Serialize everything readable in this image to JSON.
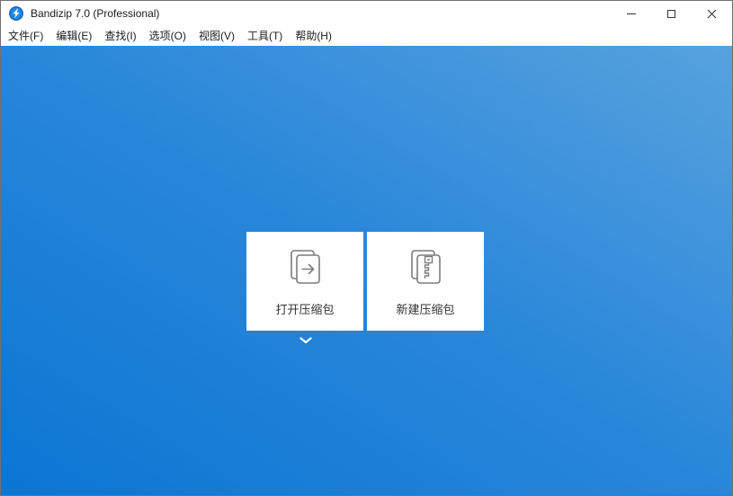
{
  "window": {
    "title": "Bandizip 7.0 (Professional)",
    "controls": {
      "minimize": "minimize-icon",
      "maximize": "maximize-icon",
      "close": "close-icon"
    }
  },
  "menu": {
    "items": [
      {
        "label": "文件(F)"
      },
      {
        "label": "编辑(E)"
      },
      {
        "label": "查找(I)"
      },
      {
        "label": "选项(O)"
      },
      {
        "label": "视图(V)"
      },
      {
        "label": "工具(T)"
      },
      {
        "label": "帮助(H)"
      }
    ]
  },
  "main": {
    "buttons": [
      {
        "id": "open-archive",
        "label": "打开压缩包",
        "icon": "open-archive-icon"
      },
      {
        "id": "new-archive",
        "label": "新建压缩包",
        "icon": "new-archive-icon"
      }
    ],
    "recent_files_expander": {
      "icon": "chevron-down-icon"
    }
  },
  "icons": {
    "app_logo": "bandizip-logo (blue circle, white bolt)",
    "minimize": "–",
    "maximize": "☐",
    "close": "✕",
    "chevron_down": "˅"
  },
  "colors": {
    "titlebar_bg": "#ffffff",
    "menubar_bg": "#ffffff",
    "content_gradient_start": "#0b76d3",
    "content_gradient_end": "#57a2de",
    "button_bg": "#fefefe",
    "button_text": "#333333",
    "icon_stroke": "#7c7c7c"
  }
}
